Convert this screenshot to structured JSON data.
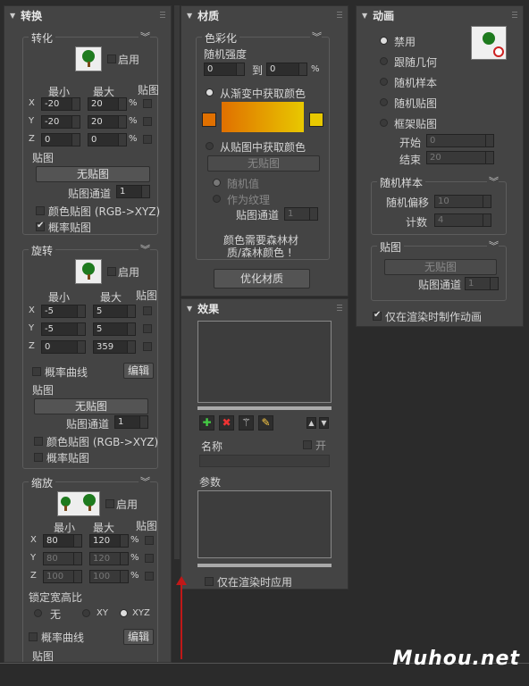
{
  "transform": {
    "title": "转换",
    "rotate_group": "转化",
    "enable": "启用",
    "min": "最小",
    "max": "最大",
    "map": "贴图",
    "axes": [
      "X",
      "Y",
      "Z"
    ],
    "percent": "%",
    "trans_rows": [
      [
        "-20",
        "20"
      ],
      [
        "-20",
        "20"
      ],
      [
        "0",
        "0"
      ]
    ],
    "map_label": "贴图",
    "no_map": "无贴图",
    "map_channel": "贴图通道",
    "channel_val": "1",
    "color_map": "颜色贴图 (RGB->XYZ)",
    "prob_map": "概率贴图",
    "rotation_group": "旋转",
    "rot_rows": [
      [
        "-5",
        "5"
      ],
      [
        "-5",
        "5"
      ],
      [
        "0",
        "359"
      ]
    ],
    "prob_curve": "概率曲线",
    "edit": "编辑",
    "scale_group": "缩放",
    "scale_rows": [
      [
        "80",
        "120"
      ],
      [
        "80",
        "120"
      ],
      [
        "100",
        "100"
      ]
    ],
    "lock_ratio": "锁定宽高比",
    "lock_none": "无",
    "lock_xy": "XY",
    "lock_xyz": "XYZ"
  },
  "material": {
    "title": "材质",
    "colorize": "色彩化",
    "rand_intensity": "随机强度",
    "min_val": "0",
    "to": "到",
    "max_val": "0",
    "percent": "%",
    "from_gradient": "从渐变中获取颜色",
    "from_map": "从贴图中获取颜色",
    "no_map": "无贴图",
    "random_value": "随机值",
    "as_texture": "作为纹理",
    "map_channel": "贴图通道",
    "channel_val": "1",
    "note_line1": "颜色需要森林材",
    "note_line2": "质/森林颜色 !",
    "optimize": "优化材质",
    "colors": {
      "left": "#e07000",
      "right": "#e8c800"
    }
  },
  "effects": {
    "title": "效果",
    "name": "名称",
    "on": "开",
    "params": "参数",
    "render_only": "仅在渲染时应用"
  },
  "animation": {
    "title": "动画",
    "options": [
      "禁用",
      "跟随几何",
      "随机样本",
      "随机贴图",
      "框架贴图"
    ],
    "start": "开始",
    "start_val": "0",
    "end": "结束",
    "end_val": "20",
    "random_sample": "随机样本",
    "random_offset": "随机偏移",
    "offset_val": "10",
    "count": "计数",
    "count_val": "4",
    "map_group": "贴图",
    "no_map": "无贴图",
    "map_channel": "贴图通道",
    "channel_val": "1",
    "render_only": "仅在渲染时制作动画"
  },
  "watermark": "Muhou.net"
}
